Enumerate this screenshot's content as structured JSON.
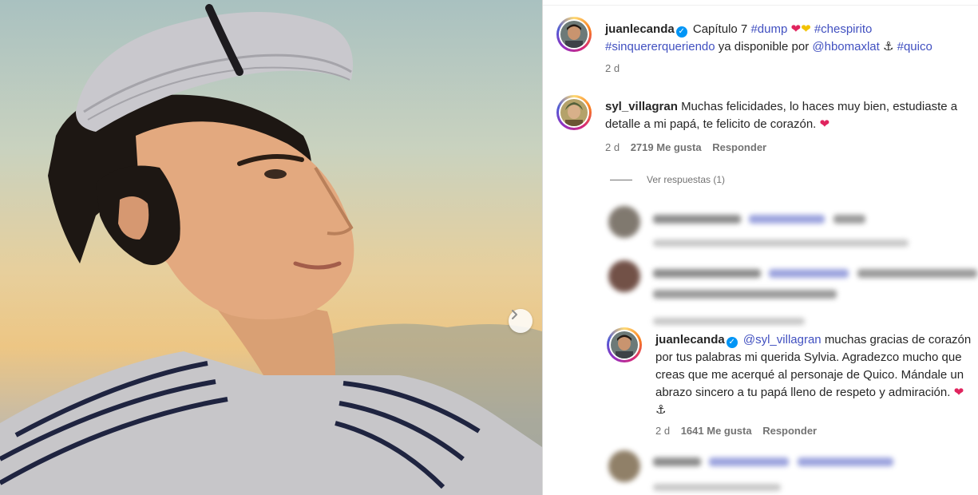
{
  "post": {
    "author": "juanlecanda",
    "caption_prefix": "Capítulo 7",
    "tags_line1": [
      "#dump",
      "#chespirito"
    ],
    "tags_line2_first": "#sinquererqueriendo",
    "caption_mid": "ya disponible por",
    "mention": "@hbomaxlat",
    "tag_last": "#quico",
    "time": "2 d"
  },
  "comments": [
    {
      "username": "syl_villagran",
      "text": "Muchas felicidades, lo haces muy bien, estudiaste a detalle a mi papá, te felicito de corazón.",
      "time": "2 d",
      "likes": "2719 Me gusta",
      "reply_label": "Responder"
    }
  ],
  "view_replies": "Ver respuestas (1)",
  "reply": {
    "username": "juanlecanda",
    "mention": "@syl_villagran",
    "text": "muchas gracias de corazón por tus palabras mi querida Sylvia. Agradezco mucho que creas que me acerqué al personaje de Quico. Mándale un abrazo sincero a tu papá lleno de respeto y admiración.",
    "time": "2 d",
    "likes": "1641 Me gusta",
    "reply_label": "Responder"
  },
  "icons": {
    "next": "chevron-right-icon",
    "verified": "verified-badge-icon"
  },
  "colors": {
    "link": "#4150c0",
    "verified": "#0095f6",
    "meta": "#737373"
  }
}
